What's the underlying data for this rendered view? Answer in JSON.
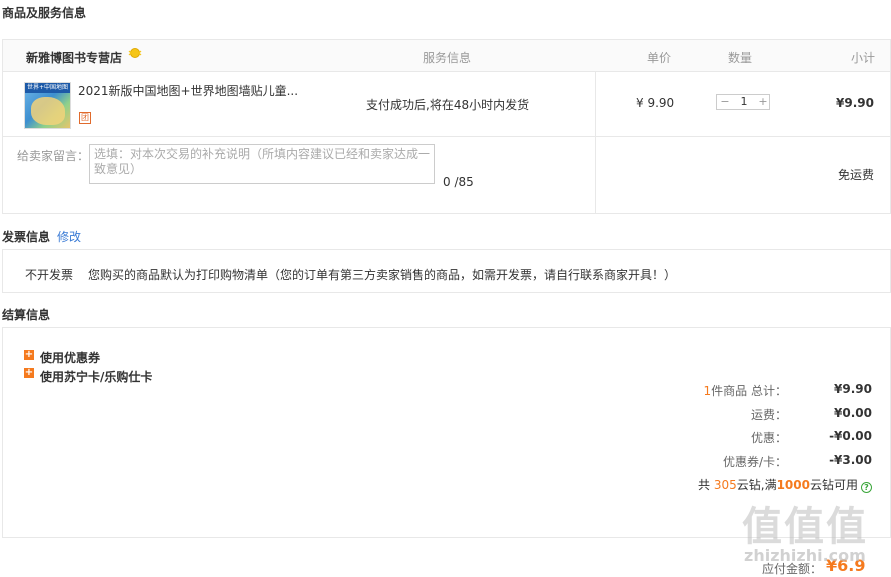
{
  "sections": {
    "goods_title": "商品及服务信息",
    "invoice_title": "发票信息",
    "invoice_edit": "修改",
    "settlement_title": "结算信息"
  },
  "order_table": {
    "store_name": "新雅博图书专营店",
    "headers": {
      "service": "服务信息",
      "unit_price": "单价",
      "quantity": "数量",
      "subtotal": "小计"
    },
    "item": {
      "thumb_text": "世界+中国地图",
      "name": "2021新版中国地图+世界地图墙贴儿童...",
      "tag": "团",
      "service_text": "支付成功后,将在48小时内发货",
      "unit_price": "¥ 9.90",
      "quantity": "1",
      "subtotal": "¥9.90"
    },
    "message_label": "给卖家留言：",
    "message_placeholder": "选填：对本次交易的补充说明（所填内容建议已经和卖家达成一致意见）",
    "char_count": "0 /85",
    "shipping": "免运费"
  },
  "invoice": {
    "type": "不开发票",
    "note": "您购买的商品默认为打印购物清单（您的订单有第三方卖家销售的商品，如需开发票，请自行联系商家开具！）"
  },
  "settlement": {
    "coupon_option": "使用优惠券",
    "card_option": "使用苏宁卡/乐购仕卡",
    "rows": [
      {
        "label_prefix": "1",
        "label": "件商品 总计：",
        "value": "¥9.90"
      },
      {
        "label": "运费：",
        "value": "¥0.00"
      },
      {
        "label": "优惠：",
        "value": "-¥0.00"
      },
      {
        "label": "优惠券/卡：",
        "value": "-¥3.00"
      }
    ],
    "yunzuan": {
      "p1": "共 ",
      "total": "305",
      "p2": "云钻,满",
      "threshold": "1000",
      "p3": "云钻可用"
    },
    "payable_label": "应付金额：",
    "payable_value": "¥6.9"
  },
  "watermark": {
    "cn": "值值值",
    "en": "zhizhizhi.com"
  },
  "colors": {
    "accent": "#f57a1e",
    "link": "#3a7bd5",
    "border": "#e8e8e8"
  }
}
